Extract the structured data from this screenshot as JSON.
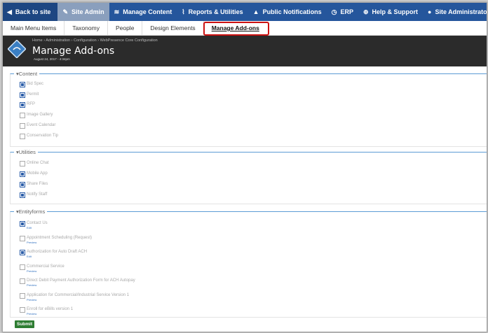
{
  "topnav": {
    "back": "Back to site",
    "site_admin": "Site Admin",
    "manage_content": "Manage Content",
    "reports": "Reports & Utilities",
    "notifications": "Public Notifications",
    "erp": "ERP",
    "help": "Help & Support",
    "site_administrator": "Site Administrator",
    "icons": {
      "back": "back-arrow-icon",
      "site_admin": "wrench-icon",
      "manage_content": "layers-icon",
      "reports": "chart-icon",
      "notifications": "megaphone-icon",
      "erp": "clock-icon",
      "help": "globe-icon",
      "user": "user-icon"
    }
  },
  "tabs": [
    "Main Menu Items",
    "Taxonomy",
    "People",
    "Design Elements",
    "Manage Add-ons"
  ],
  "header": {
    "breadcrumb": "Home › Administration › Configuration › WebPresence Core Configuration",
    "title": "Manage Add-ons",
    "date": "August 24, 2017 - 4:34pm"
  },
  "sections": {
    "content": {
      "legend": "Content",
      "items": [
        {
          "label": "Bid Spec",
          "checked": true
        },
        {
          "label": "Permit",
          "checked": true
        },
        {
          "label": "RFP",
          "checked": true
        },
        {
          "label": "Image Gallery",
          "checked": false
        },
        {
          "label": "Event Calendar",
          "checked": false
        },
        {
          "label": "Conservation Tip",
          "checked": false
        }
      ]
    },
    "utilities": {
      "legend": "Utilities",
      "items": [
        {
          "label": "Online Chat",
          "checked": false
        },
        {
          "label": "Mobile App",
          "checked": true
        },
        {
          "label": "Share Files",
          "checked": true
        },
        {
          "label": "Notify Staff",
          "checked": true
        }
      ]
    },
    "entityforms": {
      "legend": "Entityforms",
      "items": [
        {
          "label": "Contact Us",
          "checked": true,
          "link": "Edit"
        },
        {
          "label": "Appointment Scheduling (Request)",
          "checked": false,
          "link": "Preview"
        },
        {
          "label": "Authorization for Auto Draft ACH",
          "checked": true,
          "link": "Edit"
        },
        {
          "label": "Commercial Service",
          "checked": false,
          "link": "Preview"
        },
        {
          "label": "Direct Debit Payment Authorization Form for ACH Autopay",
          "checked": false,
          "link": "Preview"
        },
        {
          "label": "Application for Commercial/Industrial Service Version 1",
          "checked": false,
          "link": "Preview"
        },
        {
          "label": "Enroll for eBills version 1",
          "checked": false,
          "link": "Preview"
        }
      ]
    }
  },
  "submit": "Submit",
  "colors": {
    "nav": "#25569c",
    "header": "#2b2b2b",
    "accent": "#5b9bd5",
    "highlight": "#cc1111",
    "submit": "#2e7d32"
  }
}
